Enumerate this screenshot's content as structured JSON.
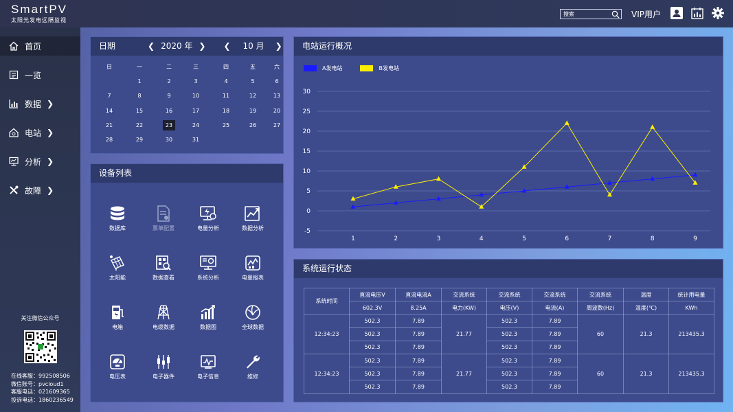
{
  "brand": {
    "name": "SmartPV",
    "subtitle": "太阳光发电远隔监视"
  },
  "header": {
    "search_placeholder": "搜索",
    "vip_label": "VIP用户",
    "icons": [
      "user-icon",
      "calendar-icon",
      "settings-gear-icon"
    ]
  },
  "sidebar": {
    "items": [
      {
        "label": "首页",
        "icon": "home-icon",
        "arrow": ""
      },
      {
        "label": "一览",
        "icon": "list-icon",
        "arrow": ""
      },
      {
        "label": "数据",
        "icon": "bar-chart-icon",
        "arrow": "❯"
      },
      {
        "label": "电站",
        "icon": "station-icon",
        "arrow": "❯"
      },
      {
        "label": "分析",
        "icon": "monitor-icon",
        "arrow": "❯"
      },
      {
        "label": "故障",
        "icon": "tools-icon",
        "arrow": "❯"
      }
    ],
    "follow": "关注微信公众号",
    "contacts": [
      "在线客服：992508506",
      "微信账号：pvcloud1",
      "客服电话：021609365",
      "投诉电话：1860236549"
    ]
  },
  "calendar": {
    "title": "日期",
    "year": "2020 年",
    "month": "10 月",
    "weekdays": [
      "日",
      "一",
      "二",
      "三",
      "四",
      "五",
      "六"
    ],
    "weeks": [
      [
        "",
        "1",
        "2",
        "3",
        "4",
        "5",
        "6"
      ],
      [
        "7",
        "8",
        "9",
        "10",
        "11",
        "12",
        "13"
      ],
      [
        "14",
        "15",
        "16",
        "17",
        "18",
        "19",
        "20"
      ],
      [
        "21",
        "22",
        "23",
        "24",
        "25",
        "26",
        "27"
      ],
      [
        "28",
        "29",
        "30",
        "31",
        "",
        "",
        ""
      ]
    ],
    "selected": "23"
  },
  "devices": {
    "title": "设备列表",
    "items": [
      {
        "label": "数据库",
        "icon": "database-icon"
      },
      {
        "label": "票单配置",
        "icon": "document-config-icon"
      },
      {
        "label": "电量分析",
        "icon": "power-analysis-icon"
      },
      {
        "label": "数据分析",
        "icon": "trend-analysis-icon"
      },
      {
        "label": "太阳能",
        "icon": "solar-panel-icon"
      },
      {
        "label": "数据查看",
        "icon": "data-view-icon"
      },
      {
        "label": "系统分析",
        "icon": "system-analysis-icon"
      },
      {
        "label": "电量报表",
        "icon": "power-report-icon"
      },
      {
        "label": "电箱",
        "icon": "electric-box-icon"
      },
      {
        "label": "电缆数据",
        "icon": "power-tower-icon"
      },
      {
        "label": "数据图",
        "icon": "data-chart-icon"
      },
      {
        "label": "全球数据",
        "icon": "globe-icon"
      },
      {
        "label": "电压表",
        "icon": "voltmeter-icon"
      },
      {
        "label": "电子器件",
        "icon": "electronic-components-icon"
      },
      {
        "label": "电子信息",
        "icon": "electronic-info-icon"
      },
      {
        "label": "维修",
        "icon": "wrench-icon"
      }
    ]
  },
  "overview": {
    "title": "电站运行概况"
  },
  "chart_data": {
    "type": "line",
    "title": "电站运行概况",
    "x": [
      1,
      2,
      3,
      4,
      5,
      6,
      7,
      8,
      9
    ],
    "series": [
      {
        "name": "A发电站",
        "color": "#1a1aff",
        "values": [
          1,
          2,
          3,
          4,
          5,
          6,
          7,
          8,
          9
        ]
      },
      {
        "name": "B发电站",
        "color": "#ffee00",
        "values": [
          3,
          6,
          8,
          1,
          11,
          22,
          4,
          21,
          7
        ]
      }
    ],
    "yticks": [
      -5,
      0,
      5,
      10,
      15,
      20,
      25,
      30
    ],
    "ylim": [
      -5,
      30
    ],
    "grid": true,
    "legend": "top-left"
  },
  "status": {
    "title": "系统运行状态",
    "headers_top": [
      "直流电压V",
      "直流电流A",
      "交流系统",
      "交流系统",
      "交流系统",
      "交流系统",
      "温度",
      "统计用电量"
    ],
    "headers_bottom": [
      "602.3V",
      "8.25A",
      "电力(KW)",
      "电压(V)",
      "电流(A)",
      "周波数(Hz)",
      "温度(℃)",
      "KWh"
    ],
    "time_header": "系统时间",
    "groups": [
      {
        "time": "12:34:23",
        "power": "21.77",
        "freq": "60",
        "temp": "21.3",
        "energy": "213435.3",
        "rows": [
          [
            "502.3",
            "7.89",
            "502.3",
            "7.89"
          ],
          [
            "502.3",
            "7.89",
            "502.3",
            "7.89"
          ],
          [
            "502.3",
            "7.89",
            "502.3",
            "7.89"
          ]
        ]
      },
      {
        "time": "12:34:23",
        "power": "21.77",
        "freq": "60",
        "temp": "21.3",
        "energy": "213435.3",
        "rows": [
          [
            "502.3",
            "7.89",
            "502.3",
            "7.89"
          ],
          [
            "502.3",
            "7.89",
            "502.3",
            "7.89"
          ],
          [
            "502.3",
            "7.89",
            "502.3",
            "7.89"
          ]
        ]
      }
    ]
  }
}
